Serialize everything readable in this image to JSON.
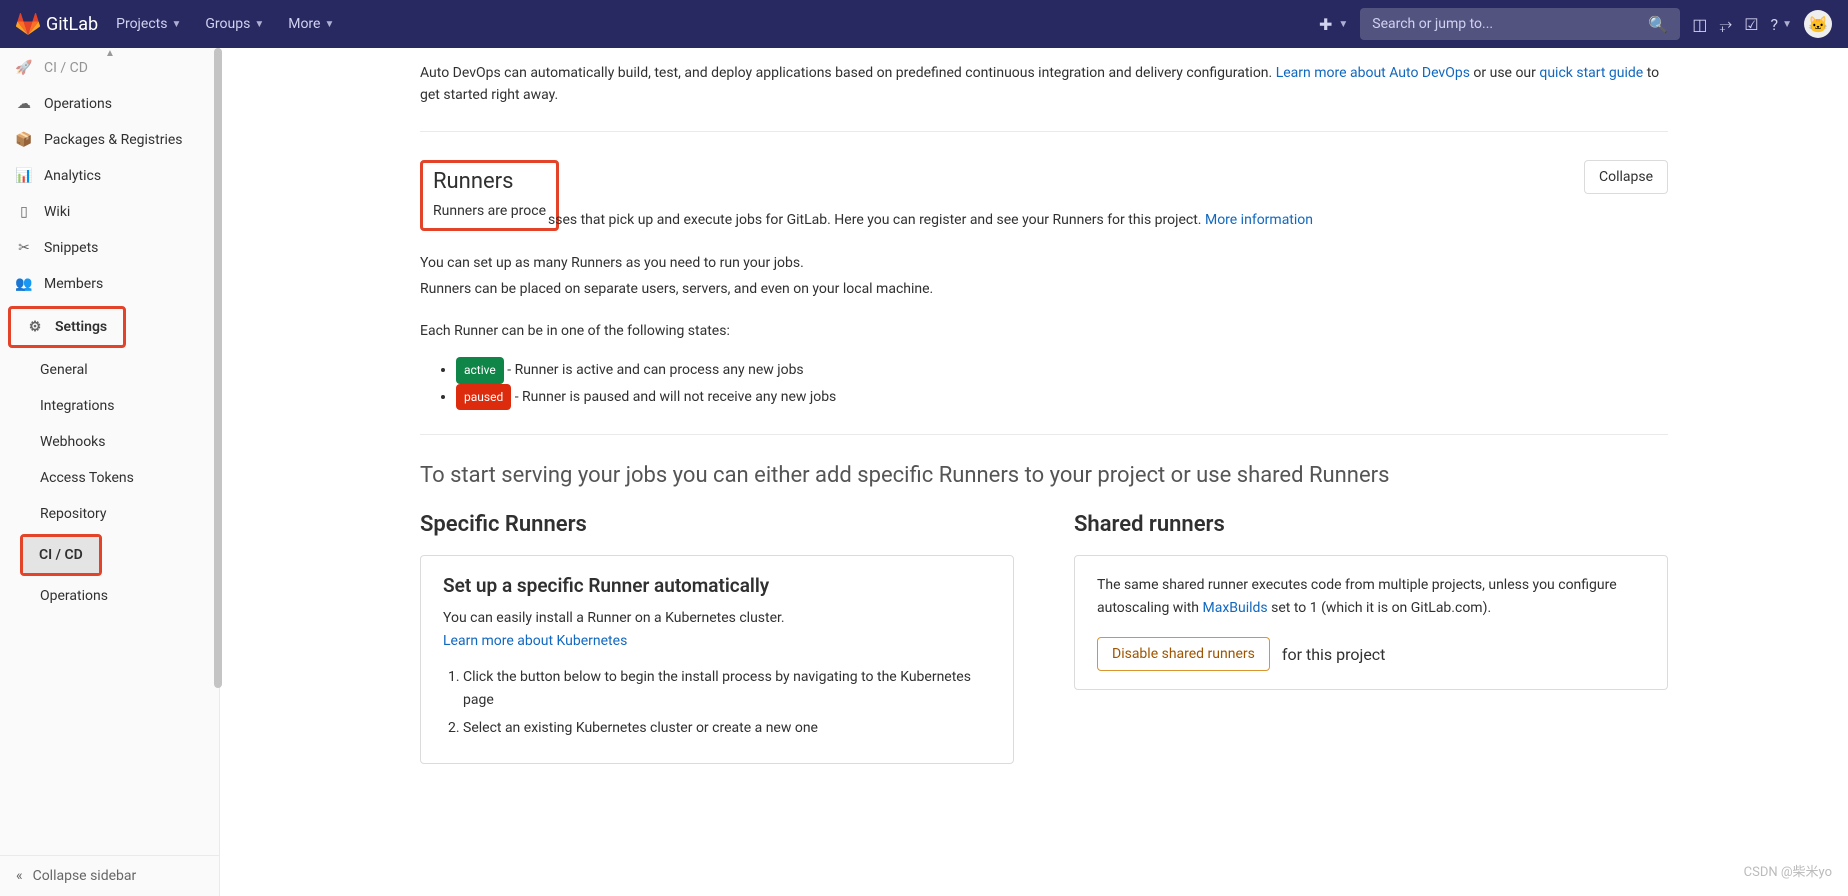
{
  "header": {
    "brand": "GitLab",
    "nav": [
      "Projects",
      "Groups",
      "More"
    ],
    "search_placeholder": "Search or jump to..."
  },
  "sidebar": {
    "items": [
      {
        "icon": "ci",
        "label": "CI / CD"
      },
      {
        "icon": "ops",
        "label": "Operations"
      },
      {
        "icon": "pkg",
        "label": "Packages & Registries"
      },
      {
        "icon": "ana",
        "label": "Analytics"
      },
      {
        "icon": "wiki",
        "label": "Wiki"
      },
      {
        "icon": "snip",
        "label": "Snippets"
      },
      {
        "icon": "mem",
        "label": "Members"
      },
      {
        "icon": "set",
        "label": "Settings"
      }
    ],
    "sub": [
      "General",
      "Integrations",
      "Webhooks",
      "Access Tokens",
      "Repository",
      "CI / CD",
      "Operations"
    ],
    "collapse": "Collapse sidebar"
  },
  "devops": {
    "text1": "Auto DevOps can automatically build, test, and deploy applications based on predefined continuous integration and delivery configuration. ",
    "link1": "Learn more about Auto DevOps",
    "text2": " or use our ",
    "link2": "quick start guide",
    "text3": " to get started right away."
  },
  "runners": {
    "title": "Runners",
    "collapse": "Collapse",
    "desc1": "Runners are processes that pick up and execute jobs for GitLab. Here you can register and see your Runners for this project. ",
    "more": "More information",
    "p1": "You can set up as many Runners as you need to run your jobs.",
    "p2": "Runners can be placed on separate users, servers, and even on your local machine.",
    "p3": "Each Runner can be in one of the following states:",
    "badge_active": "active",
    "state_active": " - Runner is active and can process any new jobs",
    "badge_paused": "paused",
    "state_paused": " - Runner is paused and will not receive any new jobs"
  },
  "serving": "To start serving your jobs you can either add specific Runners to your project or use shared Runners",
  "specific": {
    "title": "Specific Runners",
    "card_title": "Set up a specific Runner automatically",
    "p1": "You can easily install a Runner on a Kubernetes cluster. ",
    "link": "Learn more about Kubernetes",
    "step1": "Click the button below to begin the install process by navigating to the Kubernetes page",
    "step2": "Select an existing Kubernetes cluster or create a new one"
  },
  "shared": {
    "title": "Shared runners",
    "p1": "The same shared runner executes code from multiple projects, unless you configure autoscaling with ",
    "link": "MaxBuilds",
    "p2": " set to 1 (which it is on GitLab.com).",
    "btn": "Disable shared runners",
    "after": "for this project"
  },
  "watermark": "CSDN @柴米yo"
}
